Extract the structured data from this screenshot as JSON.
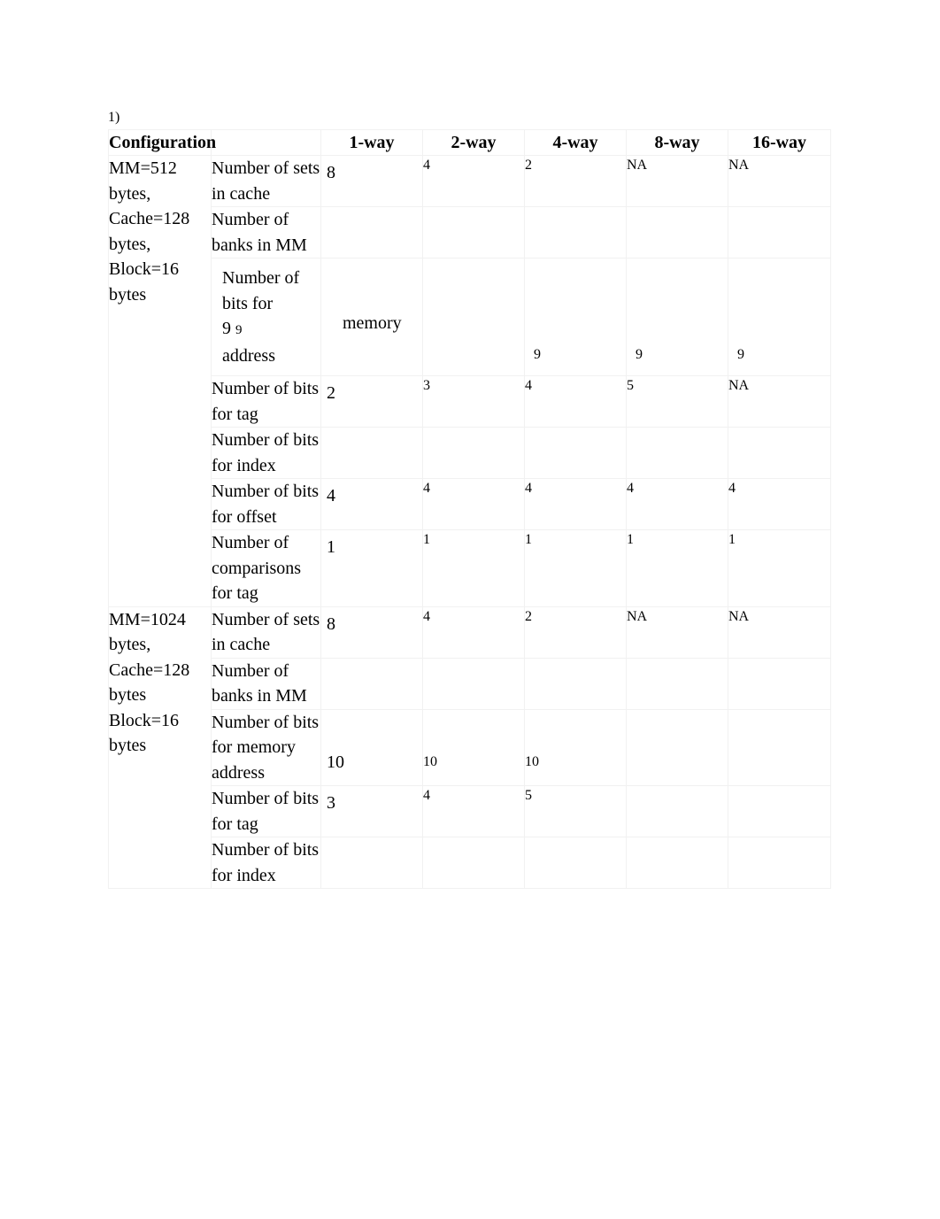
{
  "document": {
    "question_label": "1)"
  },
  "table": {
    "header": {
      "config_label": "Configuration",
      "blank_label": "",
      "ways": [
        "1-way",
        "2-way",
        "4-way",
        "8-way",
        "16-way"
      ]
    },
    "blocks": [
      {
        "config": "MM=512 bytes, Cache=128 bytes, Block=16 bytes",
        "rows": [
          {
            "metric": "Number of sets in cache",
            "values": [
              "8",
              "4",
              "2",
              "NA",
              "NA"
            ]
          },
          {
            "metric": "Number of banks in MM",
            "values": [
              "",
              "",
              "",
              "",
              ""
            ]
          },
          {
            "metric_line1": "Number of",
            "metric_line2": "bits for",
            "metric_line3_big": "9",
            "metric_line3_small": "9",
            "metric_line4": "address",
            "metric": "Number of bits for 9 9 address",
            "values": [
              "memory",
              "",
              "9",
              "9",
              "9"
            ]
          },
          {
            "metric": "Number of bits for tag",
            "values": [
              "2",
              "3",
              "4",
              "5",
              "NA"
            ]
          },
          {
            "metric": "Number of bits for index",
            "values": [
              "",
              "",
              "",
              "",
              ""
            ]
          },
          {
            "metric": "Number of bits for offset",
            "values": [
              "4",
              "4",
              "4",
              "4",
              "4"
            ]
          },
          {
            "metric": "Number of comparisons for tag",
            "values": [
              "1",
              "1",
              "1",
              "1",
              "1"
            ]
          }
        ]
      },
      {
        "config": "MM=1024 bytes, Cache=128 bytes Block=16 bytes",
        "rows": [
          {
            "metric": "Number of sets in cache",
            "values": [
              "8",
              "4",
              "2",
              "NA",
              "NA"
            ]
          },
          {
            "metric": "Number of banks in MM",
            "values": [
              "",
              "",
              "",
              "",
              ""
            ]
          },
          {
            "metric": "Number of bits for memory address",
            "values": [
              "10",
              "10",
              "10",
              "",
              ""
            ]
          },
          {
            "metric": "Number of bits for tag",
            "values": [
              "3",
              "4",
              "5",
              "",
              ""
            ]
          },
          {
            "metric": "Number of bits for index",
            "values": [
              "",
              "",
              "",
              "",
              ""
            ]
          }
        ]
      }
    ]
  }
}
